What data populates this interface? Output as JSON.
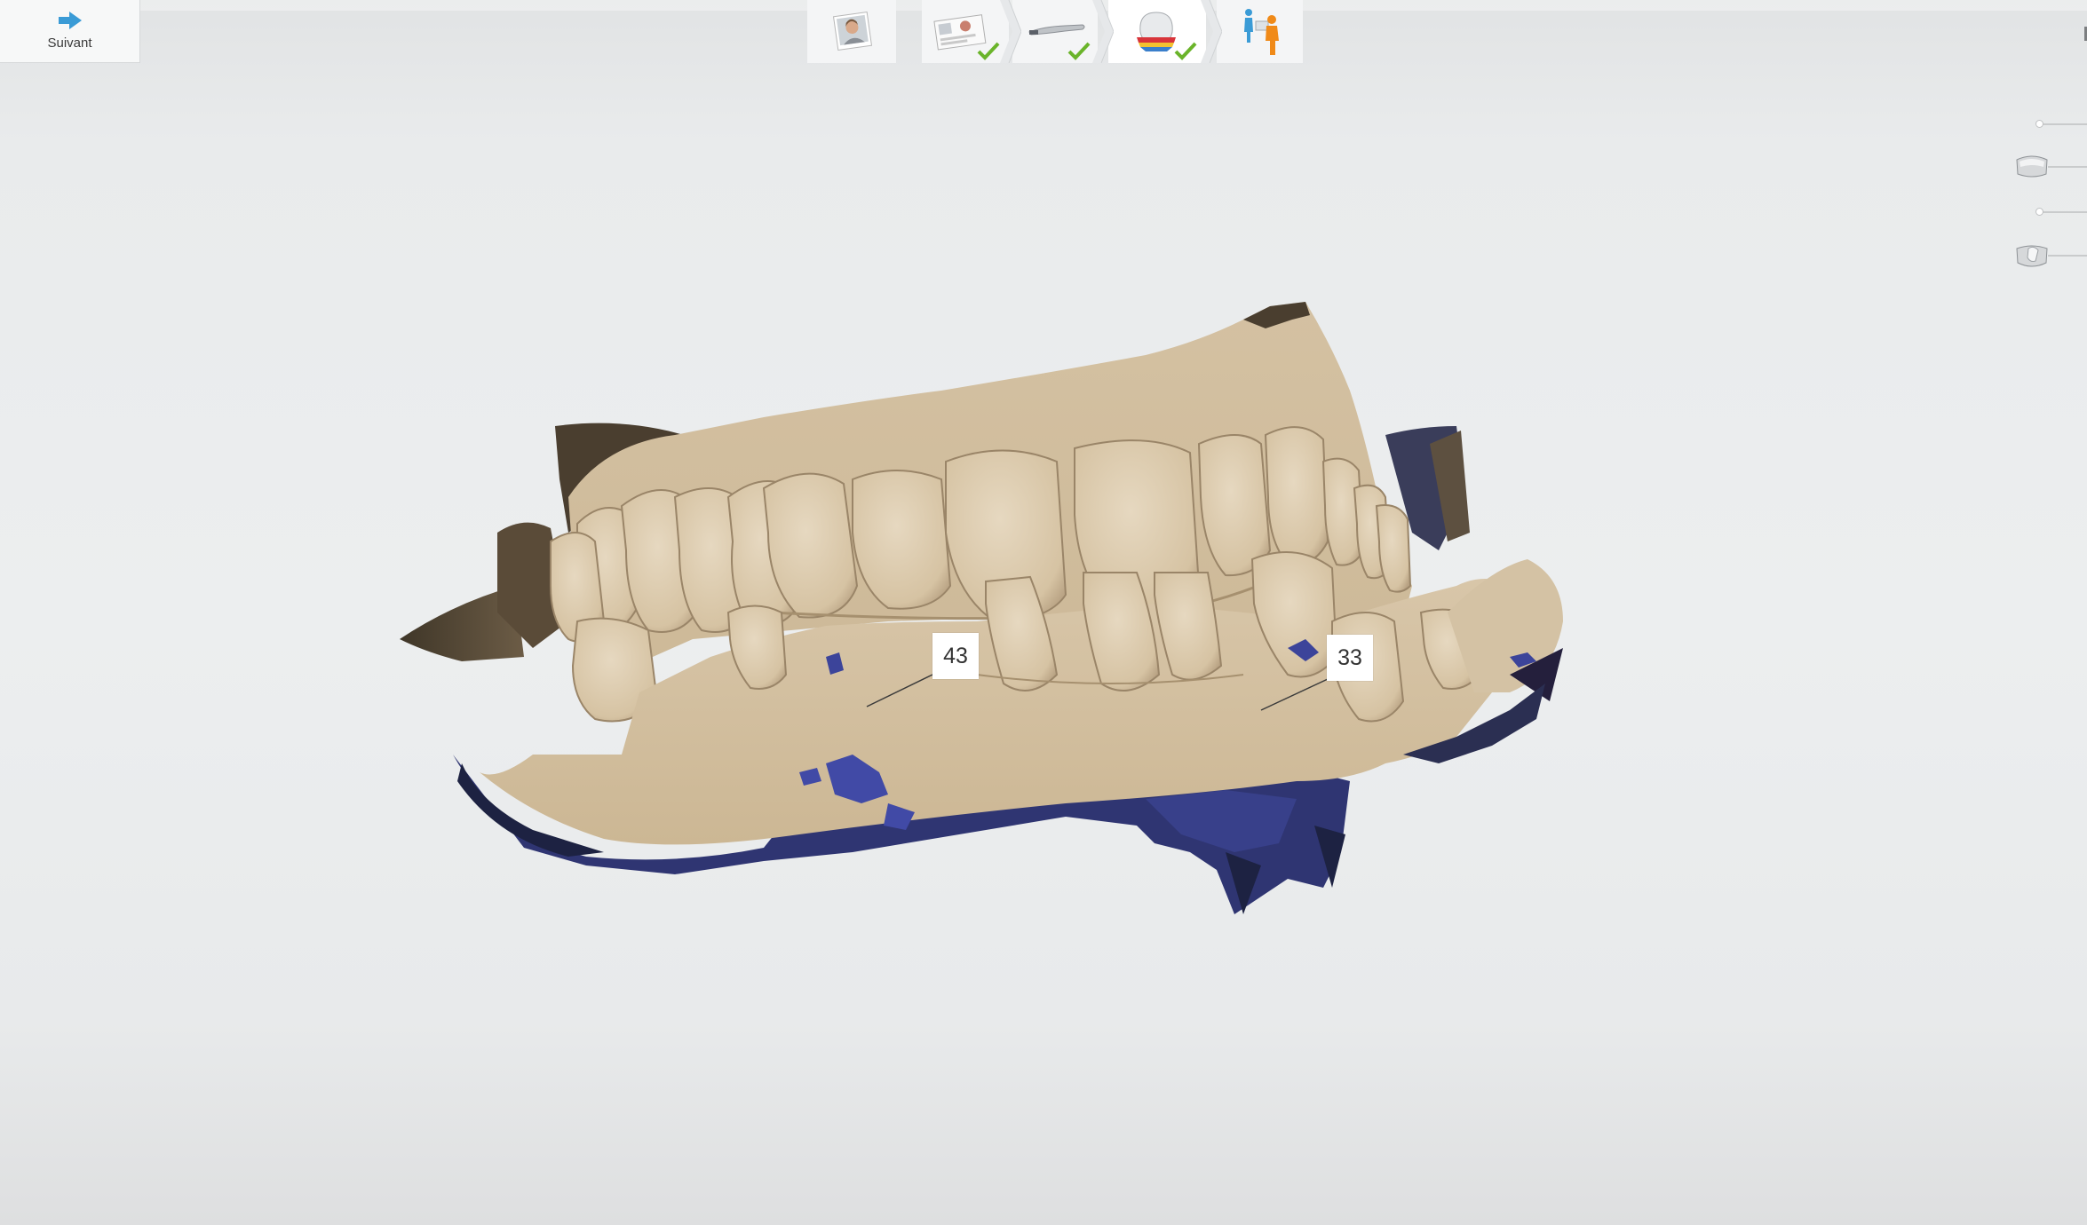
{
  "toolbar": {
    "next_label": "Suivant"
  },
  "workflow": {
    "steps": [
      {
        "name": "patient",
        "icon": "patient-photo-icon",
        "completed": false
      },
      {
        "name": "order-form",
        "icon": "order-form-icon",
        "completed": true
      },
      {
        "name": "scan",
        "icon": "scanner-icon",
        "completed": true
      },
      {
        "name": "analyze",
        "icon": "tooth-analysis-icon",
        "completed": true,
        "active": true
      },
      {
        "name": "send",
        "icon": "send-to-lab-icon",
        "completed": false
      }
    ]
  },
  "viewport": {
    "labels": [
      {
        "text": "43"
      },
      {
        "text": "33"
      }
    ]
  },
  "colors": {
    "accent": "#3a9bd6",
    "check": "#6ab42a",
    "tissue": "#d8c6a9",
    "scan_gap": "#2f3572"
  }
}
